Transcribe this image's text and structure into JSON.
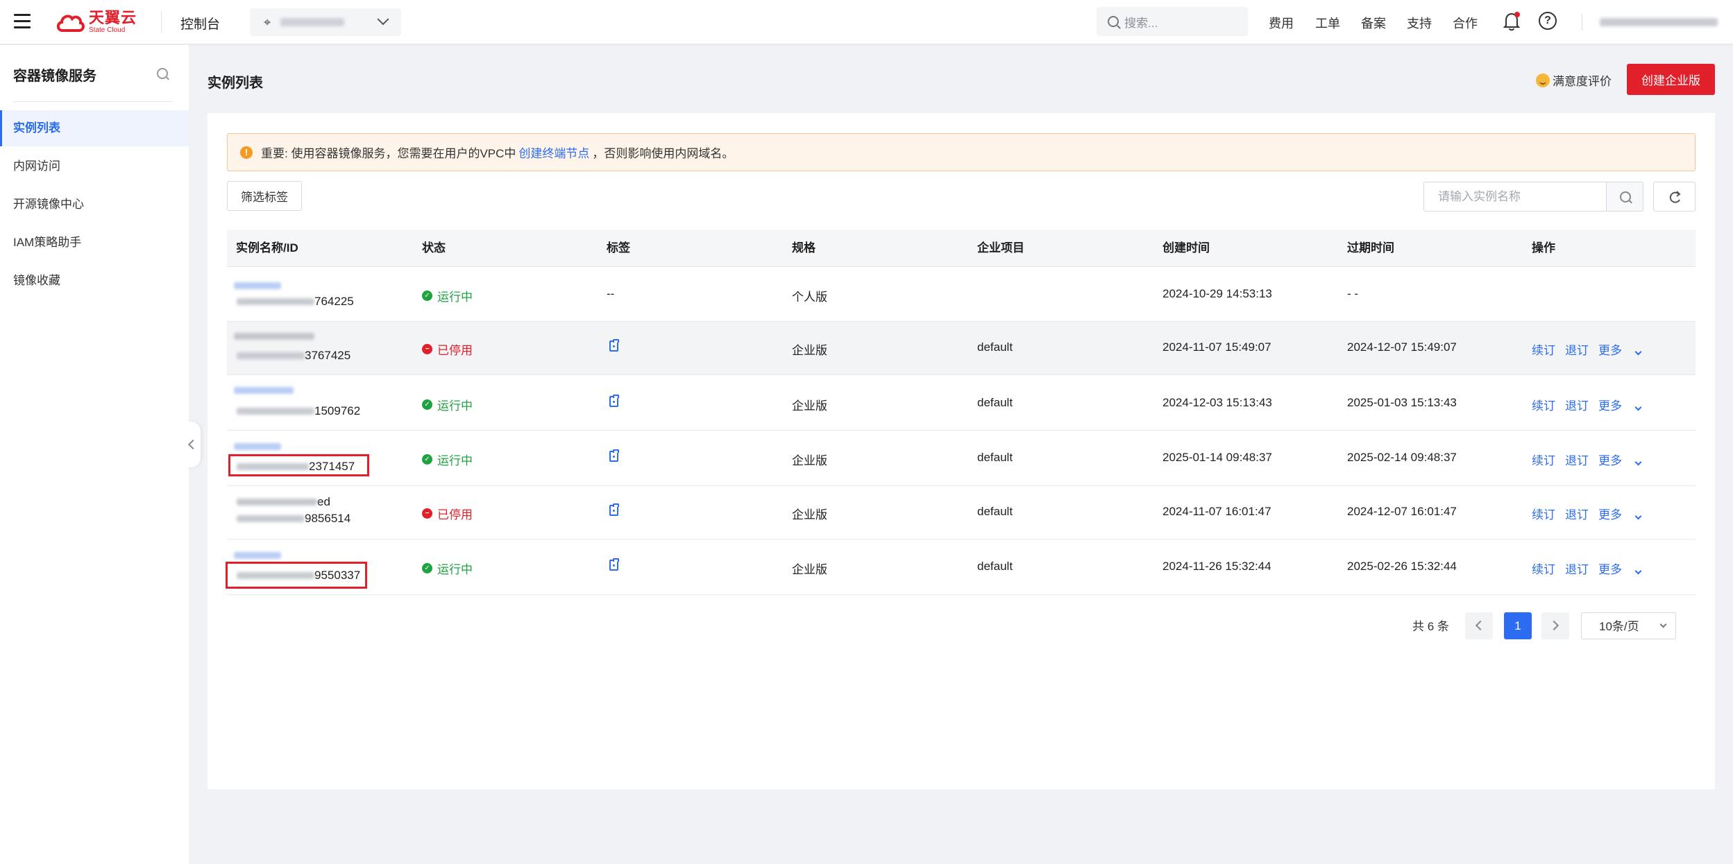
{
  "topbar": {
    "logo_cn": "天翼云",
    "logo_en": "State Cloud",
    "console": "控制台",
    "search_placeholder": "搜索...",
    "nav": [
      "费用",
      "工单",
      "备案",
      "支持",
      "合作"
    ]
  },
  "sidebar": {
    "title": "容器镜像服务",
    "items": [
      "实例列表",
      "内网访问",
      "开源镜像中心",
      "IAM策略助手",
      "镜像收藏"
    ]
  },
  "page": {
    "title": "实例列表",
    "satisfaction": "满意度评价",
    "create_button": "创建企业版"
  },
  "notice": {
    "prefix": "重要: 使用容器镜像服务，您需要在用户的VPC中",
    "link": "创建终端节点",
    "suffix": "，否则影响使用内网域名。"
  },
  "toolbar": {
    "filter_button": "筛选标签",
    "search_placeholder": "请输入实例名称"
  },
  "table": {
    "headers": [
      "实例名称/ID",
      "状态",
      "标签",
      "规格",
      "企业项目",
      "创建时间",
      "过期时间",
      "操作"
    ],
    "rows": [
      {
        "name_visible": "",
        "id_suffix": "764225",
        "status": "运行中",
        "status_kind": "running",
        "tag": "--",
        "spec": "个人版",
        "project": "",
        "created": "2024-10-29 14:53:13",
        "expires": "- -",
        "ops": []
      },
      {
        "name_visible": "",
        "id_suffix": "3767425",
        "status": "已停用",
        "status_kind": "stopped",
        "tag": "icon",
        "spec": "企业版",
        "project": "default",
        "created": "2024-11-07 15:49:07",
        "expires": "2024-12-07 15:49:07",
        "ops": [
          "续订",
          "退订",
          "更多"
        ]
      },
      {
        "name_visible": "",
        "id_suffix": "1509762",
        "status": "运行中",
        "status_kind": "running",
        "tag": "icon",
        "spec": "企业版",
        "project": "default",
        "created": "2024-12-03 15:13:43",
        "expires": "2025-01-03 15:13:43",
        "ops": [
          "续订",
          "退订",
          "更多"
        ]
      },
      {
        "name_visible": "",
        "id_suffix": "2371457",
        "status": "运行中",
        "status_kind": "running",
        "tag": "icon",
        "spec": "企业版",
        "project": "default",
        "created": "2025-01-14 09:48:37",
        "expires": "2025-02-14 09:48:37",
        "ops": [
          "续订",
          "退订",
          "更多"
        ]
      },
      {
        "name_visible": "ed",
        "id_suffix": "9856514",
        "status": "已停用",
        "status_kind": "stopped",
        "tag": "icon",
        "spec": "企业版",
        "project": "default",
        "created": "2024-11-07 16:01:47",
        "expires": "2024-12-07 16:01:47",
        "ops": [
          "续订",
          "退订",
          "更多"
        ]
      },
      {
        "name_visible": "",
        "id_suffix": "9550337",
        "status": "运行中",
        "status_kind": "running",
        "tag": "icon",
        "spec": "企业版",
        "project": "default",
        "created": "2024-11-26 15:32:44",
        "expires": "2025-02-26 15:32:44",
        "ops": [
          "续订",
          "退订",
          "更多"
        ]
      }
    ]
  },
  "pagination": {
    "total": "共 6 条",
    "current": "1",
    "page_size": "10条/页"
  },
  "colors": {
    "brand_red": "#e1202b",
    "link_blue": "#2b6cf0",
    "running_green": "#1fa340"
  }
}
